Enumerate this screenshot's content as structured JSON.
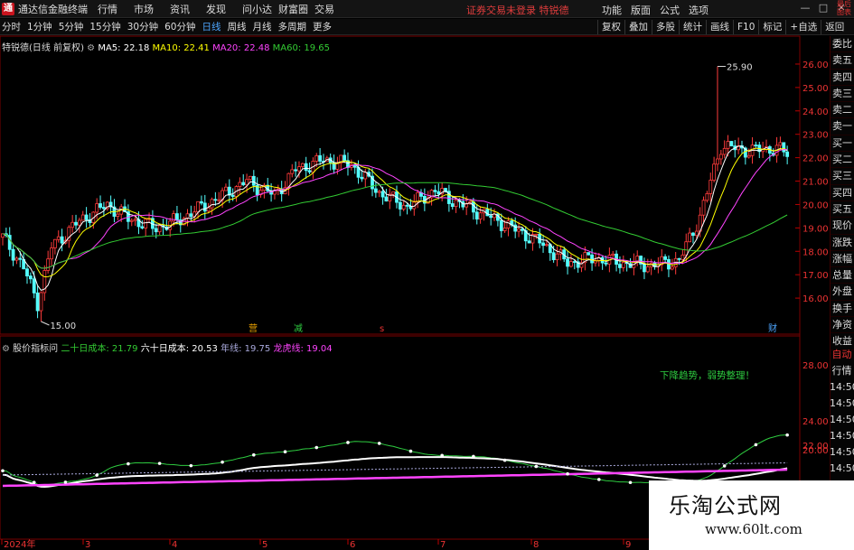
{
  "app": {
    "logo_mark": "通",
    "title": "通达信金融终端"
  },
  "menu": [
    "行情",
    "市场",
    "资讯",
    "发现",
    "问小达",
    "财富圈",
    "交易"
  ],
  "notice": "证券交易未登录  特锐德",
  "sysmenu": [
    "功能",
    "版面",
    "公式",
    "选项"
  ],
  "window_controls": [
    "—",
    "□",
    "✕"
  ],
  "tabs": [
    "分时",
    "1分钟",
    "5分钟",
    "15分钟",
    "30分钟",
    "60分钟",
    "日线",
    "周线",
    "月线",
    "多周期",
    "更多"
  ],
  "active_tab": "日线",
  "right_tools": [
    "复权",
    "叠加",
    "多股",
    "统计",
    "画线",
    "F10",
    "标记",
    "+自选",
    "返回"
  ],
  "main_legend": {
    "name": "特锐德(日线 前复权)",
    "ma5": "MA5: 22.18",
    "ma10": "MA10: 22.41",
    "ma20": "MA20: 22.48",
    "ma60": "MA60: 19.65"
  },
  "sub_legend": {
    "name": "股价指标问",
    "l1": "二十日成本: 21.79",
    "l2": "六十日成本: 20.53",
    "l3": "年线: 19.75",
    "l4": "龙虎线: 19.04"
  },
  "annotation": "下降趋势，弱势整理！",
  "price_axis": [
    "26.00",
    "25.00",
    "24.00",
    "23.00",
    "22.00",
    "21.00",
    "20.00",
    "19.00",
    "18.00",
    "17.00",
    "16.00"
  ],
  "sub_axis": [
    "28.00",
    "24.00",
    "22.00",
    "20.00"
  ],
  "price_labels": {
    "high": "25.90",
    "low": "15.00"
  },
  "markers": [
    "营",
    "减",
    "s",
    "财"
  ],
  "right_panel": [
    "委比",
    "卖五",
    "卖四",
    "卖三",
    "卖二",
    "卖一",
    "买一",
    "买二",
    "买三",
    "买四",
    "买五",
    "现价",
    "涨跌",
    "涨幅",
    "总量",
    "外盘",
    "换手",
    "净资",
    "收益"
  ],
  "right_panel2": [
    "自动",
    "行情",
    "14:50",
    "14:50",
    "14:50",
    "14:50",
    "14:50",
    "14:50",
    "14:50"
  ],
  "x_axis": [
    "2024年",
    "3",
    "4",
    "5",
    "6",
    "7",
    "8",
    "9"
  ],
  "top_right": "最后\n图表",
  "watermark": {
    "title": "乐淘公式网",
    "url": "www.60lt.com"
  },
  "colors": {
    "up": "#ff3b3b",
    "down": "#54ffff",
    "ma5": "#ffffff",
    "ma10": "#ffff00",
    "ma20": "#ff44ff",
    "ma60": "#33cc33"
  }
}
